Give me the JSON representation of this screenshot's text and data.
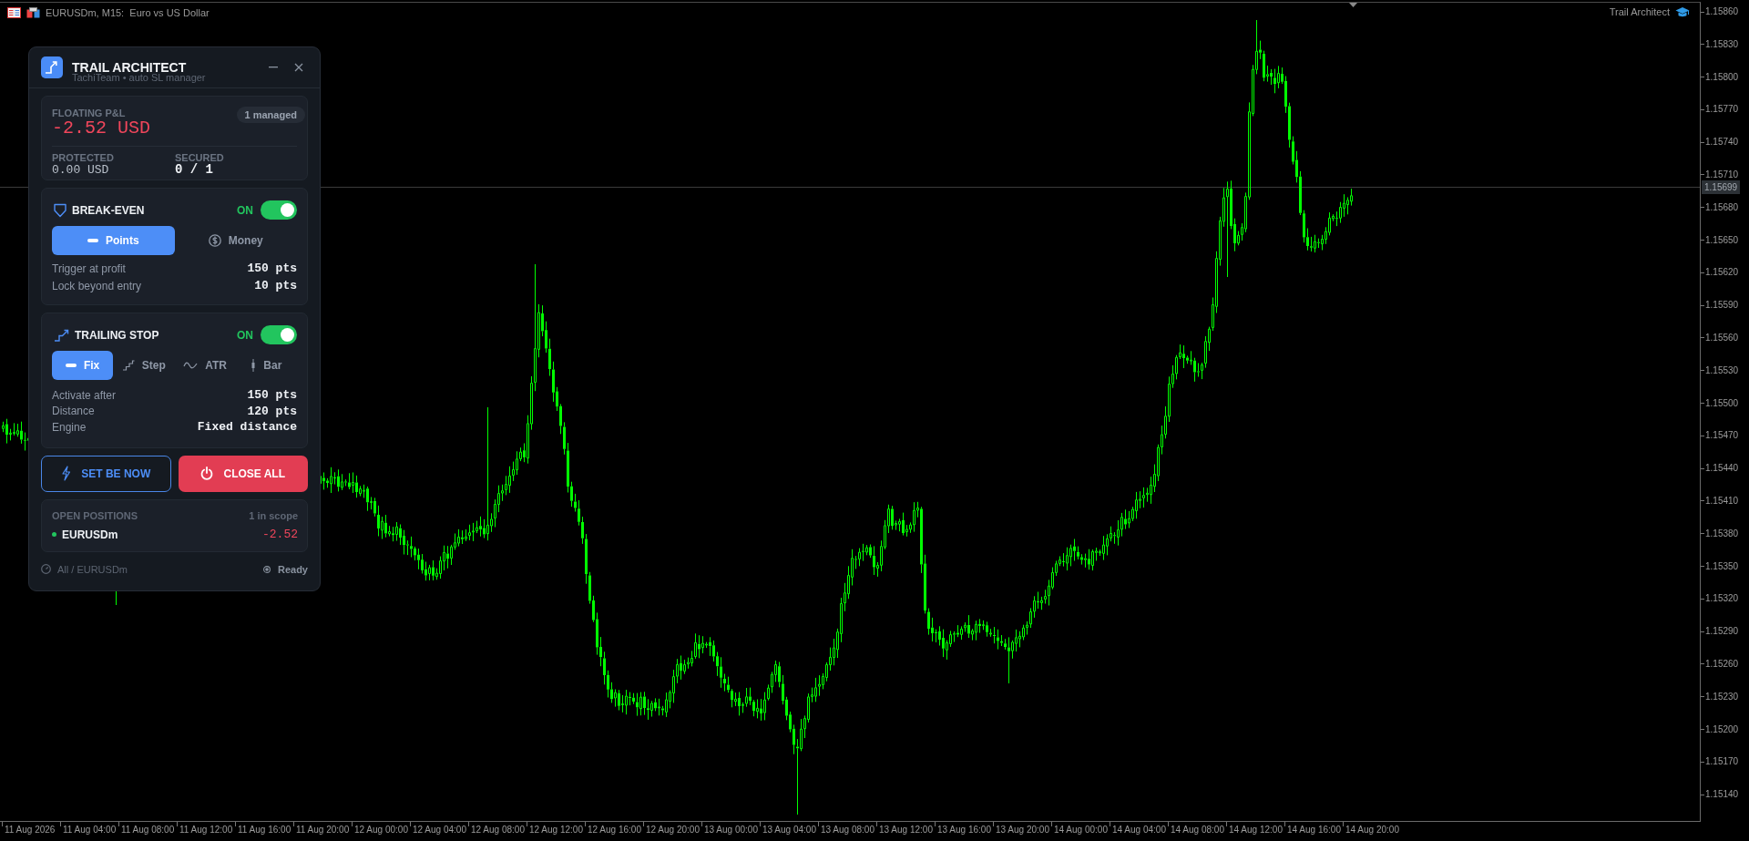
{
  "chart": {
    "title": "EURUSDm, M15:  Euro vs US Dollar",
    "expert_label": "Trail Architect",
    "price_axis": {
      "labels": [
        "1.15860",
        "1.15830",
        "1.15800",
        "1.15770",
        "1.15740",
        "1.15710",
        "1.15680",
        "1.15650",
        "1.15620",
        "1.15590",
        "1.15560",
        "1.15530",
        "1.15500",
        "1.15470",
        "1.15440",
        "1.15410",
        "1.15380",
        "1.15350",
        "1.15320",
        "1.15290",
        "1.15260",
        "1.15230",
        "1.15200",
        "1.15170",
        "1.15140"
      ],
      "current_price": "1.15699"
    },
    "time_axis": {
      "labels": [
        "11 Aug 2026",
        "11 Aug 04:00",
        "11 Aug 08:00",
        "11 Aug 12:00",
        "11 Aug 16:00",
        "11 Aug 20:00",
        "12 Aug 00:00",
        "12 Aug 04:00",
        "12 Aug 08:00",
        "12 Aug 12:00",
        "12 Aug 16:00",
        "12 Aug 20:00",
        "13 Aug 00:00",
        "13 Aug 04:00",
        "13 Aug 08:00",
        "13 Aug 12:00",
        "13 Aug 16:00",
        "13 Aug 20:00",
        "14 Aug 00:00",
        "14 Aug 04:00",
        "14 Aug 08:00",
        "14 Aug 12:00",
        "14 Aug 16:00",
        "14 Aug 20:00"
      ]
    }
  },
  "panel": {
    "title": "TRAIL ARCHITECT",
    "subtitle": "TachiTeam • auto SL manager",
    "summary": {
      "floating_label": "FLOATING P&L",
      "floating_value": "-2.52 USD",
      "badge": "1 managed",
      "stats": [
        {
          "label": "PROTECTED",
          "value": "0.00 USD"
        },
        {
          "label": "SECURED",
          "value": "0 / 1"
        }
      ]
    },
    "break_even": {
      "title": "BREAK-EVEN",
      "status": "ON",
      "enabled": true,
      "modes": [
        {
          "label": "Points",
          "selected": true
        },
        {
          "label": "Money",
          "selected": false
        }
      ],
      "rows": [
        {
          "label": "Trigger at profit",
          "value": "150 pts"
        },
        {
          "label": "Lock beyond entry",
          "value": "10 pts"
        }
      ]
    },
    "trailing_stop": {
      "title": "TRAILING STOP",
      "status": "ON",
      "enabled": true,
      "modes": [
        {
          "label": "Fix",
          "selected": true
        },
        {
          "label": "Step",
          "selected": false
        },
        {
          "label": "ATR",
          "selected": false
        },
        {
          "label": "Bar",
          "selected": false
        }
      ],
      "rows": [
        {
          "label": "Activate after",
          "value": "150 pts"
        },
        {
          "label": "Distance",
          "value": "120 pts"
        },
        {
          "label": "Engine",
          "value": "Fixed distance"
        }
      ]
    },
    "actions": [
      {
        "label": "SET BE NOW",
        "kind": "outline"
      },
      {
        "label": "CLOSE ALL",
        "kind": "danger"
      }
    ],
    "positions": {
      "title": "OPEN POSITIONS",
      "count": "1 in scope",
      "items": [
        {
          "symbol": "EURUSDm",
          "pnl": "-2.52"
        }
      ]
    },
    "footer": {
      "scope": "All / EURUSDm",
      "status": "Ready"
    }
  }
}
